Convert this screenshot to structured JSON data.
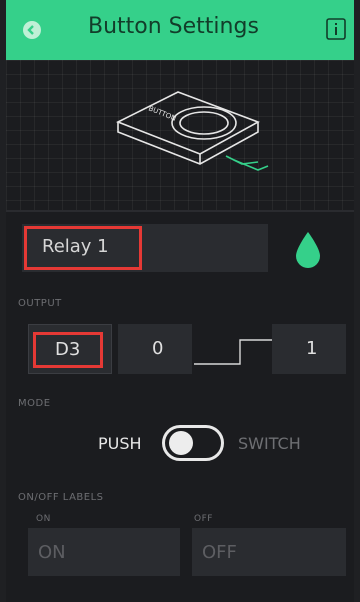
{
  "header": {
    "title": "Button Settings",
    "back_icon": "back-arrow-icon",
    "info_icon": "info-icon",
    "color": "#35d08a"
  },
  "illustration": {
    "icon": "button-device-icon"
  },
  "name": {
    "value": "Relay 1",
    "color_picker_icon": "drop-icon",
    "color": "#35d08a"
  },
  "output": {
    "section_label": "OUTPUT",
    "pin": "D3",
    "min": "0",
    "max": "1"
  },
  "mode": {
    "section_label": "MODE",
    "left_label": "PUSH",
    "right_label": "SWITCH",
    "value": "PUSH"
  },
  "labels": {
    "section_label": "ON/OFF LABELS",
    "on_label": "ON",
    "off_label": "OFF",
    "on_placeholder": "ON",
    "off_placeholder": "OFF"
  }
}
